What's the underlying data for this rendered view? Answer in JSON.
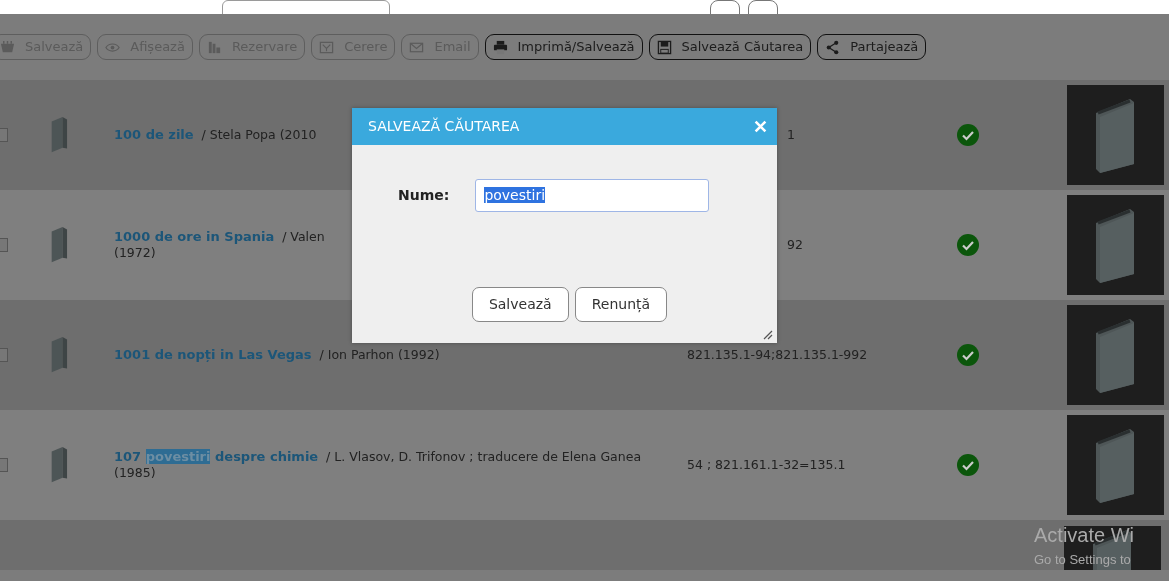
{
  "toolbar": [
    {
      "label": "Salvează",
      "kind": "basket",
      "disabled": true
    },
    {
      "label": "Afișează",
      "kind": "eye",
      "disabled": true
    },
    {
      "label": "Rezervare",
      "kind": "books",
      "disabled": true
    },
    {
      "label": "Cerere",
      "kind": "inbox",
      "disabled": true
    },
    {
      "label": "Email",
      "kind": "mail",
      "disabled": true
    },
    {
      "label": "Imprimă/Salvează",
      "kind": "printer",
      "disabled": false
    },
    {
      "label": "Salvează Căutarea",
      "kind": "floppy",
      "disabled": false
    },
    {
      "label": "Partajează",
      "kind": "share",
      "disabled": false
    }
  ],
  "results": [
    {
      "title": [
        {
          "text": "100 de zile",
          "highlighted": false
        }
      ],
      "byline": [
        "/ Stela Popa  (2010"
      ],
      "classification": "1",
      "available": true,
      "checked": false
    },
    {
      "title": [
        {
          "text": "1000 de ore in Spania",
          "highlighted": false
        }
      ],
      "byline": [
        "/ Valen",
        "(1972)"
      ],
      "classification": "92",
      "available": true,
      "checked": false
    },
    {
      "title": [
        {
          "text": "1001 de nopți in Las Vegas",
          "highlighted": false
        }
      ],
      "byline": [
        "/ Ion Parhon  (1992)"
      ],
      "classification": "821.135.1-94;821.135.1-992",
      "available": true,
      "checked": false
    },
    {
      "title": [
        {
          "text": "107 ",
          "highlighted": false
        },
        {
          "text": "povestiri",
          "highlighted": true
        },
        {
          "text": " despre chimie",
          "highlighted": false
        }
      ],
      "byline": [
        "/ L. Vlasov, D. Trifonov ; traducere de Elena Ganea  (1985)"
      ],
      "classification": "54 ; 821.161.1-32=135.1",
      "available": true,
      "checked": false
    }
  ],
  "dialog": {
    "title": "SALVEAZĂ CĂUTAREA",
    "field_label": "Nume:",
    "field_value": "povestiri",
    "value_selected": true,
    "buttons": [
      "Salvează",
      "Renunță"
    ]
  },
  "activation_notice": {
    "title": "Activate Wi",
    "subtitle": "Go to Settings to"
  }
}
